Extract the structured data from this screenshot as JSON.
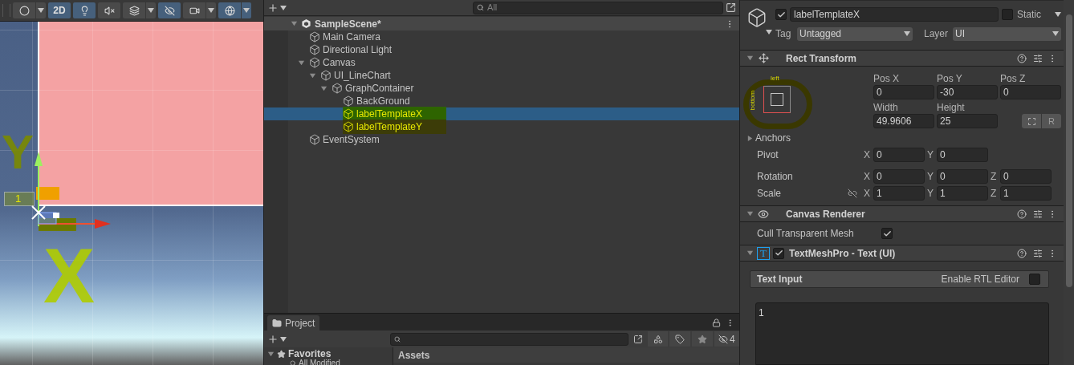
{
  "scene_toolbar": {
    "buttons": [
      {
        "kind": "shading",
        "selected": false
      },
      {
        "kind": "label",
        "label": "2D",
        "selected": true
      },
      {
        "kind": "lighting",
        "selected": true
      },
      {
        "kind": "audio",
        "selected": false
      },
      {
        "kind": "effects",
        "selected": false
      },
      {
        "kind": "visibility",
        "selected": true
      },
      {
        "kind": "camera",
        "selected": false
      },
      {
        "kind": "gizmos",
        "selected": true
      }
    ]
  },
  "scene_view": {
    "rect_label": "1",
    "annotations": [
      {
        "text": "Y",
        "kind": "y"
      },
      {
        "text": "X",
        "kind": "x"
      }
    ]
  },
  "hierarchy": {
    "search": {
      "placeholder": "All"
    },
    "scene": {
      "name": "SampleScene*",
      "expanded": true
    },
    "items": [
      {
        "label": "Main Camera",
        "selected": false,
        "marked": false
      },
      {
        "label": "Directional Light",
        "selected": false,
        "marked": false
      },
      {
        "label": "Canvas",
        "selected": false,
        "marked": false,
        "expanded": true,
        "children": [
          {
            "label": "UI_LineChart",
            "selected": false,
            "marked": false,
            "expanded": true,
            "children": [
              {
                "label": "GraphContainer",
                "selected": false,
                "marked": false,
                "expanded": true,
                "children": [
                  {
                    "label": "BackGround",
                    "selected": false,
                    "marked": false
                  },
                  {
                    "label": "labelTemplateX",
                    "selected": true,
                    "marked": true
                  },
                  {
                    "label": "labelTemplateY",
                    "selected": false,
                    "marked": true
                  }
                ]
              }
            ]
          }
        ]
      },
      {
        "label": "EventSystem",
        "selected": false,
        "marked": false
      }
    ]
  },
  "project": {
    "tab": "Project",
    "hidden_count": "4",
    "favorites": {
      "label": "Favorites",
      "expanded": true,
      "children": [
        {
          "label": "All Modified"
        }
      ]
    },
    "assets_header": "Assets"
  },
  "inspector": {
    "object": {
      "active": true,
      "name": "labelTemplateX",
      "static": false,
      "static_label": "Static"
    },
    "tag": {
      "label": "Tag",
      "value": "Untagged"
    },
    "layer": {
      "label": "Layer",
      "value": "UI"
    },
    "components": [
      {
        "kind": "rect_transform",
        "title": "Rect Transform",
        "expanded": true,
        "anchor_preset": {
          "top": "left",
          "side": "bottom"
        },
        "fields": [
          {
            "label": "Pos X",
            "value": "0"
          },
          {
            "label": "Pos Y",
            "value": "-30"
          },
          {
            "label": "Pos Z",
            "value": "0"
          },
          {
            "label": "Width",
            "value": "49.9606"
          },
          {
            "label": "Height",
            "value": "25"
          }
        ],
        "raw_button": "R",
        "anchors": {
          "label": "Anchors",
          "expanded": false
        },
        "vectors": [
          {
            "label": "Pivot",
            "axes": [
              {
                "axis": "X",
                "value": "0"
              },
              {
                "axis": "Y",
                "value": "0"
              }
            ]
          },
          {
            "label": "Rotation",
            "axes": [
              {
                "axis": "X",
                "value": "0"
              },
              {
                "axis": "Y",
                "value": "0"
              },
              {
                "axis": "Z",
                "value": "0"
              }
            ]
          },
          {
            "label": "Scale",
            "constrained": false,
            "axes": [
              {
                "axis": "X",
                "value": "1"
              },
              {
                "axis": "Y",
                "value": "1"
              },
              {
                "axis": "Z",
                "value": "1"
              }
            ]
          }
        ]
      },
      {
        "kind": "canvas_renderer",
        "title": "Canvas Renderer",
        "expanded": true,
        "toggles": [
          {
            "label": "Cull Transparent Mesh",
            "checked": true
          }
        ]
      },
      {
        "kind": "text_mesh_pro",
        "icon_text": "T",
        "title": "TextMeshPro - Text (UI)",
        "expanded": true,
        "enabled": true,
        "section": "Text Input",
        "rtl": {
          "label": "Enable RTL Editor",
          "checked": false
        },
        "text": "1"
      }
    ]
  }
}
